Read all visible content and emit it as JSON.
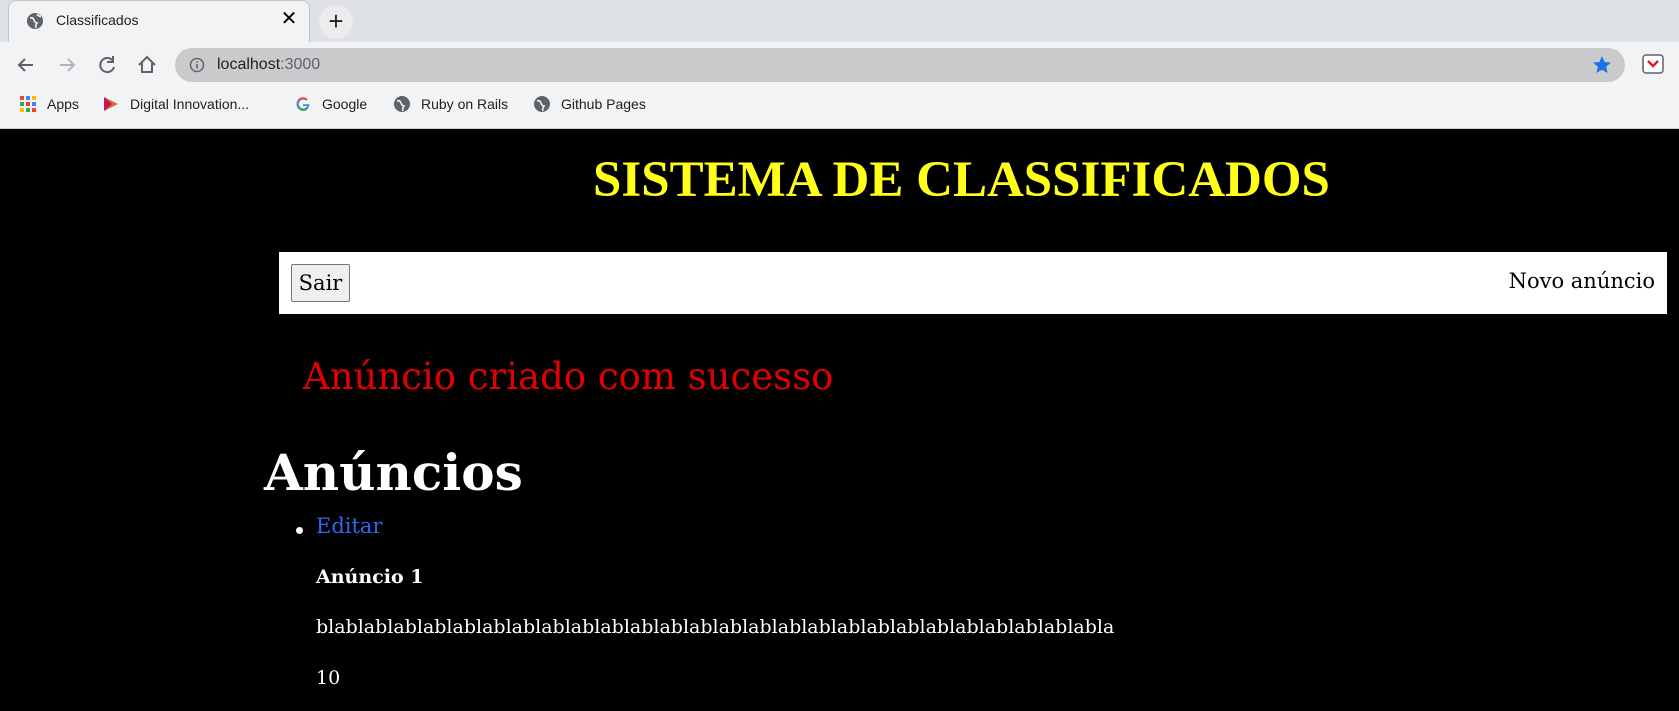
{
  "browser": {
    "tab_title": "Classificados",
    "url_host": "localhost",
    "url_port": ":3000",
    "bookmarks": [
      "Apps",
      "Digital Innovation...",
      "Google",
      "Ruby on Rails",
      "Github Pages"
    ],
    "icons": {
      "tab_favicon": "globe-icon",
      "star": "bookmark-star-icon",
      "extension": "pocket-icon"
    },
    "colors": {
      "star": "#1a73e8",
      "chrome": "#f1f3f4"
    }
  },
  "page": {
    "site_title": "SISTEMA DE CLASSIFICADOS",
    "nav": {
      "logout_label": "Sair",
      "new_ad_label": "Novo anúncio"
    },
    "flash_message": "Anúncio criado com sucesso",
    "heading": "Anúncios",
    "ads": [
      {
        "edit_label": "Editar",
        "title": "Anúncio 1",
        "description": "blablablablablablablablablablablablablablablablablablablablablablablablablablabla",
        "price": "10"
      }
    ],
    "colors": {
      "title": "#ffff1a",
      "flash": "#e00000",
      "link": "#2a6bf2",
      "background": "#000000"
    }
  }
}
